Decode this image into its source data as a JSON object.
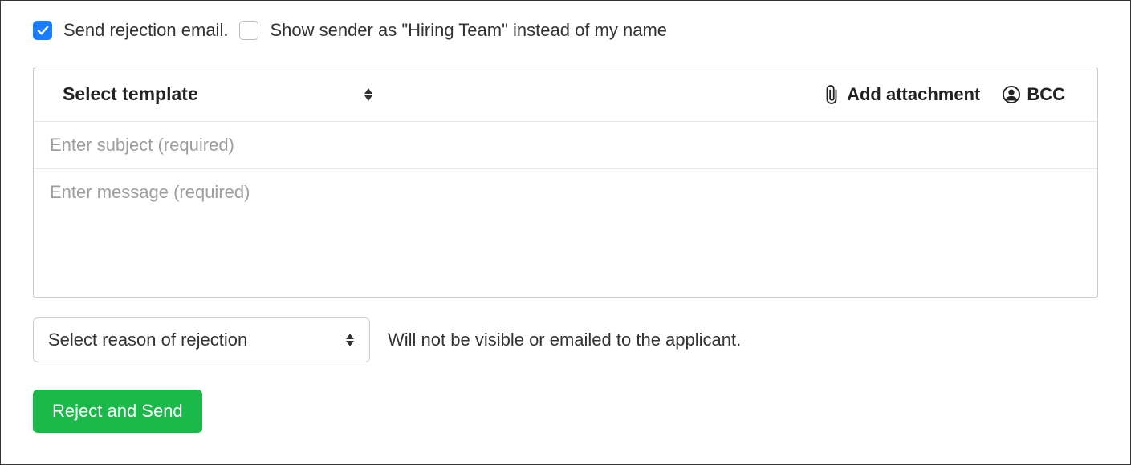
{
  "options": {
    "send_rejection_label": "Send rejection email.",
    "show_sender_label": "Show sender as \"Hiring Team\" instead of my name"
  },
  "email": {
    "template_label": "Select template",
    "add_attachment_label": "Add attachment",
    "bcc_label": "BCC",
    "subject_placeholder": "Enter subject (required)",
    "subject_value": "",
    "message_placeholder": "Enter message (required)",
    "message_value": ""
  },
  "reason": {
    "select_label": "Select reason of rejection",
    "hint": "Will not be visible or emailed to the applicant."
  },
  "actions": {
    "reject_send_label": "Reject and Send"
  }
}
